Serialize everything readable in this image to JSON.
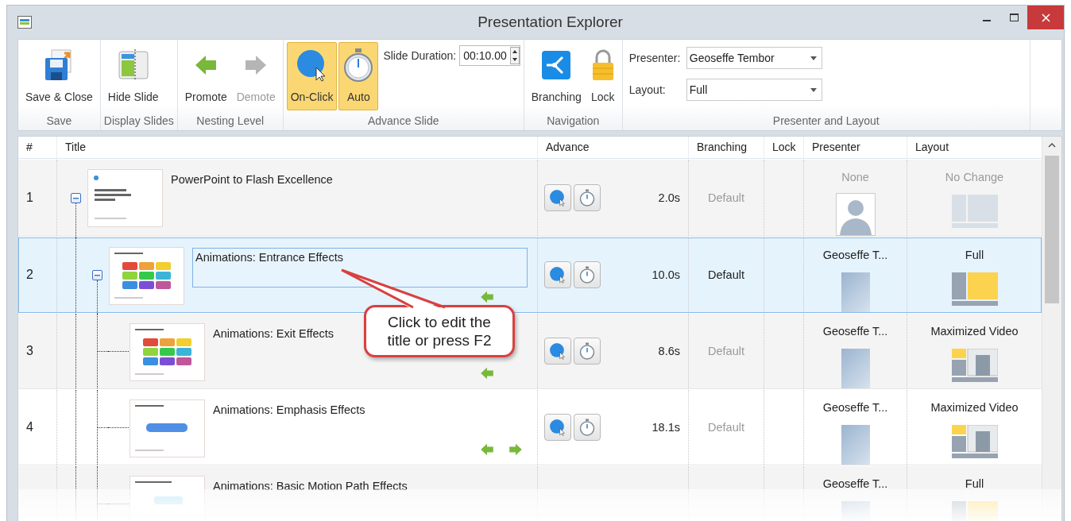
{
  "window": {
    "title": "Presentation Explorer"
  },
  "ribbon": {
    "groups": [
      {
        "label": "Save",
        "items": [
          {
            "kind": "button",
            "label": "Save & Close",
            "selected": false,
            "disabled": false
          }
        ]
      },
      {
        "label": "Display Slides",
        "items": [
          {
            "kind": "button",
            "label": "Hide Slide",
            "selected": false,
            "disabled": false
          }
        ]
      },
      {
        "label": "Nesting Level",
        "items": [
          {
            "kind": "button",
            "label": "Promote",
            "selected": false,
            "disabled": false
          },
          {
            "kind": "button",
            "label": "Demote",
            "selected": false,
            "disabled": true
          }
        ]
      },
      {
        "label": "Advance Slide",
        "items": [
          {
            "kind": "button",
            "label": "On-Click",
            "selected": true,
            "disabled": false
          },
          {
            "kind": "button",
            "label": "Auto",
            "selected": true,
            "disabled": false
          },
          {
            "kind": "spinner",
            "label": "Slide Duration:",
            "value": "00:10.00"
          }
        ]
      },
      {
        "label": "Navigation",
        "items": [
          {
            "kind": "button",
            "label": "Branching",
            "selected": false,
            "disabled": false
          },
          {
            "kind": "button",
            "label": "Lock",
            "selected": false,
            "disabled": false
          }
        ]
      },
      {
        "label": "Presenter and Layout",
        "items": [
          {
            "kind": "dropdown",
            "label": "Presenter:",
            "value": "Geoseffe Tembor"
          },
          {
            "kind": "dropdown",
            "label": "Layout:",
            "value": "Full"
          }
        ]
      }
    ]
  },
  "table": {
    "columns": [
      "#",
      "Title",
      "Advance",
      "Branching",
      "Lock",
      "Presenter",
      "Layout"
    ],
    "rows": [
      {
        "number": "1",
        "title": "PowerPoint to Flash Excellence",
        "selected": false,
        "editing": false,
        "expanded": true,
        "can_promote": false,
        "can_demote": false,
        "duration": "2.0s",
        "branching": "Default",
        "presenter": {
          "name": "None",
          "kind": "none"
        },
        "layout": {
          "name": "No Change",
          "kind": "no_change"
        },
        "children": [
          {
            "number": "2",
            "title": "Animations: Entrance Effects",
            "selected": true,
            "editing": true,
            "expanded": true,
            "can_promote": true,
            "can_demote": false,
            "duration": "10.0s",
            "branching": "Default",
            "presenter": {
              "name": "Geoseffe T...",
              "kind": "photo"
            },
            "layout": {
              "name": "Full",
              "kind": "full"
            },
            "children": [
              {
                "number": "3",
                "title": "Animations: Exit Effects",
                "selected": false,
                "editing": false,
                "can_promote": true,
                "can_demote": false,
                "duration": "8.6s",
                "branching": "Default",
                "presenter": {
                  "name": "Geoseffe T...",
                  "kind": "photo"
                },
                "layout": {
                  "name": "Maximized Video",
                  "kind": "maximized_video"
                }
              },
              {
                "number": "4",
                "title": "Animations: Emphasis Effects",
                "selected": false,
                "editing": false,
                "can_promote": true,
                "can_demote": true,
                "duration": "18.1s",
                "branching": "Default",
                "presenter": {
                  "name": "Geoseffe T...",
                  "kind": "photo"
                },
                "layout": {
                  "name": "Maximized Video",
                  "kind": "maximized_video"
                }
              },
              {
                "title": "Animations: Basic Motion Path Effects",
                "selected": false,
                "editing": false,
                "can_promote": false,
                "can_demote": false,
                "presenter": {
                  "name": "Geoseffe T...",
                  "kind": "photo"
                },
                "layout": {
                  "name": "Full",
                  "kind": "full"
                }
              }
            ]
          }
        ]
      }
    ]
  },
  "callout": {
    "text": "Click to edit the title or press F2"
  }
}
